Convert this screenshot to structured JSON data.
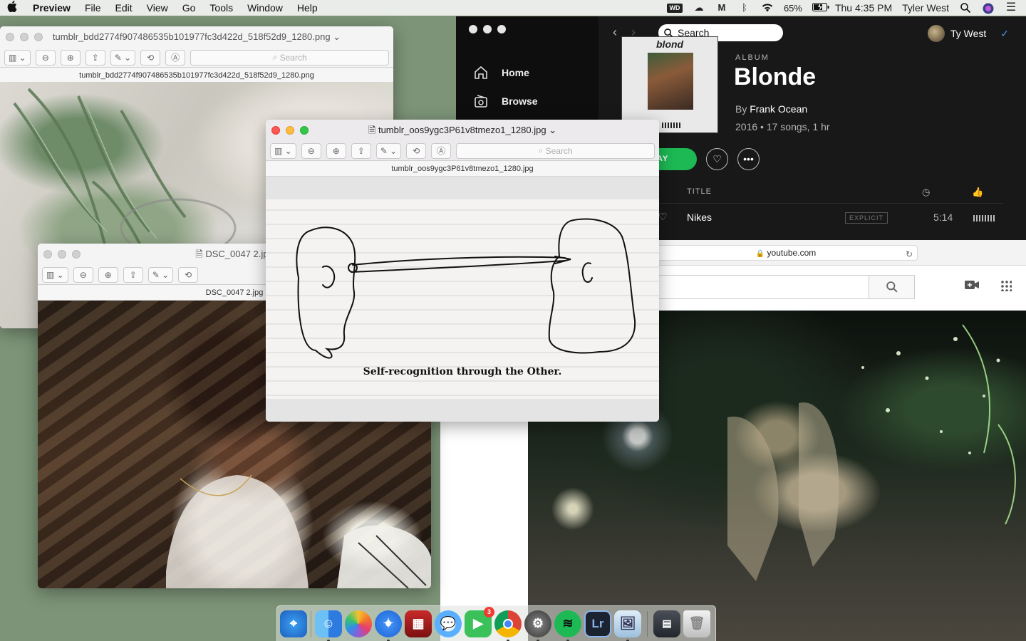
{
  "menubar": {
    "apple": "",
    "items": [
      "Preview",
      "File",
      "Edit",
      "View",
      "Go",
      "Tools",
      "Window",
      "Help"
    ],
    "wd_label": "WD",
    "battery": "65%",
    "clock": "Thu 4:35 PM",
    "user": "Tyler West"
  },
  "preview_back": {
    "filename": "tumblr_bdd2774f907486535b101977fc3d422d_518f52d9_1280.png",
    "search_placeholder": "Search"
  },
  "preview_dsc": {
    "title": "DSC_0047 2.jpg",
    "filename": "DSC_0047 2.jpg"
  },
  "preview_front": {
    "filename": "tumblr_oos9ygc3P61v8tmezo1_1280.jpg",
    "search_placeholder": "Search",
    "caption": "Self-recognition through the Other."
  },
  "spotify": {
    "nav": [
      {
        "label": "Home"
      },
      {
        "label": "Browse"
      }
    ],
    "search": "Search",
    "user": "Ty West",
    "album_cover_text": "blond",
    "type": "ALBUM",
    "title": "Blonde",
    "by_prefix": "By",
    "artist": "Frank Ocean",
    "meta": "2016 • 17 songs, 1 hr",
    "play_label": "AY",
    "col_title": "TITLE",
    "track": {
      "name": "Nikes",
      "explicit": "EXPLICIT",
      "duration": "5:14"
    }
  },
  "youtube": {
    "url": "youtube.com"
  },
  "dock": {
    "messages_badge": "3",
    "lightroom_label": "Lr",
    "apps": [
      "safari-widget",
      "finder",
      "photos",
      "safari",
      "photo-booth",
      "messages",
      "facetime",
      "chrome",
      "system-preferences",
      "spotify",
      "lightroom",
      "preview",
      "downloads",
      "trash"
    ]
  },
  "colors": {
    "desktop": "#7d9478",
    "spotify_green": "#1db954",
    "close": "#fc5753",
    "minimize": "#fdbc40",
    "zoom": "#33c748"
  }
}
